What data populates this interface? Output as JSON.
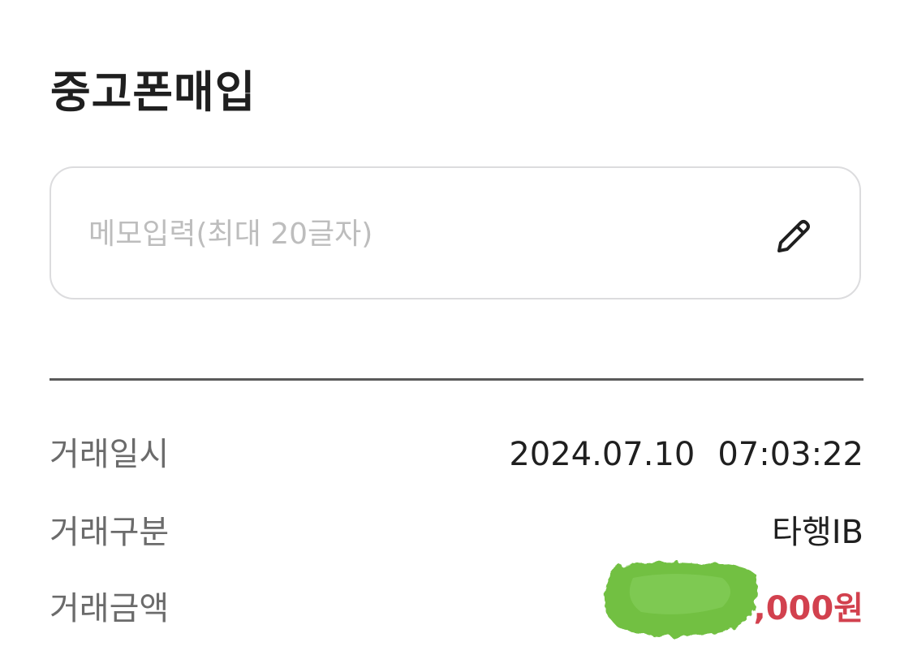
{
  "header": {
    "title": "중고폰매입"
  },
  "memo": {
    "placeholder": "메모입력(최대 20글자)",
    "value": "",
    "edit_icon": "pencil-icon"
  },
  "details": [
    {
      "label": "거래일시",
      "date": "2024.07.10",
      "time": "07:03:22"
    },
    {
      "label": "거래구분",
      "value": "타행IB"
    },
    {
      "label": "거래금액",
      "value": ",000원",
      "value_color": "#d2414e"
    }
  ],
  "colors": {
    "text_primary": "#1f1f1f",
    "text_label": "#6b6b6b",
    "amount": "#d2414e",
    "border": "#dcdcde",
    "redaction": "#72c043"
  }
}
